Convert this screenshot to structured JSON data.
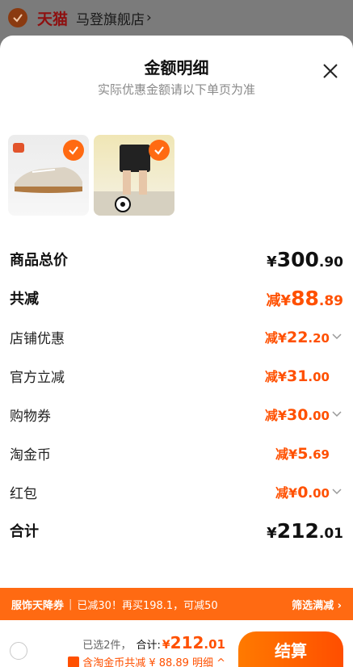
{
  "store": {
    "platform": "天猫",
    "name": "马登旗舰店",
    "chevron": "›"
  },
  "sheet": {
    "title": "金额明细",
    "subtitle": "实际优惠金额请以下单页为准",
    "thumbnails": [
      {
        "name": "sneaker",
        "checked": true
      },
      {
        "name": "shorts",
        "checked": true
      }
    ]
  },
  "breakdown": {
    "total": {
      "label": "商品总价",
      "prefix": "¥",
      "int": "300",
      "dec": ".90"
    },
    "discount": {
      "label": "共减",
      "prefix": "减¥",
      "int": "88",
      "dec": ".89"
    },
    "store_coupon": {
      "label": "店铺优惠",
      "prefix": "减¥",
      "int": "22",
      "dec": ".20",
      "expandable": true
    },
    "official": {
      "label": "官方立减",
      "prefix": "减¥",
      "int": "31",
      "dec": ".00"
    },
    "shopping_coupon": {
      "label": "购物券",
      "prefix": "减¥",
      "int": "30",
      "dec": ".00",
      "expandable": true
    },
    "taojinbi": {
      "label": "淘金币",
      "prefix": "减¥",
      "int": "5",
      "dec": ".69"
    },
    "hongbao": {
      "label": "红包",
      "prefix": "减¥",
      "int": "0",
      "dec": ".00",
      "expandable": true
    },
    "sum": {
      "label": "合计",
      "prefix": "¥",
      "int": "212",
      "dec": ".01"
    }
  },
  "promo": {
    "tag": "服饰天降券",
    "text": "已减30！再买198.1，可减50",
    "filter": "筛选满减 ›"
  },
  "checkout": {
    "selected": "已选2件，",
    "total_label": "合计:",
    "total_prefix": "¥",
    "total_int": "212",
    "total_dec": ".01",
    "saving": "含淘金币共减 ¥ 88.89",
    "detail": "明细 ^",
    "pay_label": "结算"
  },
  "colors": {
    "accent": "#ff5000",
    "promo_bg": "#ff6a12"
  }
}
